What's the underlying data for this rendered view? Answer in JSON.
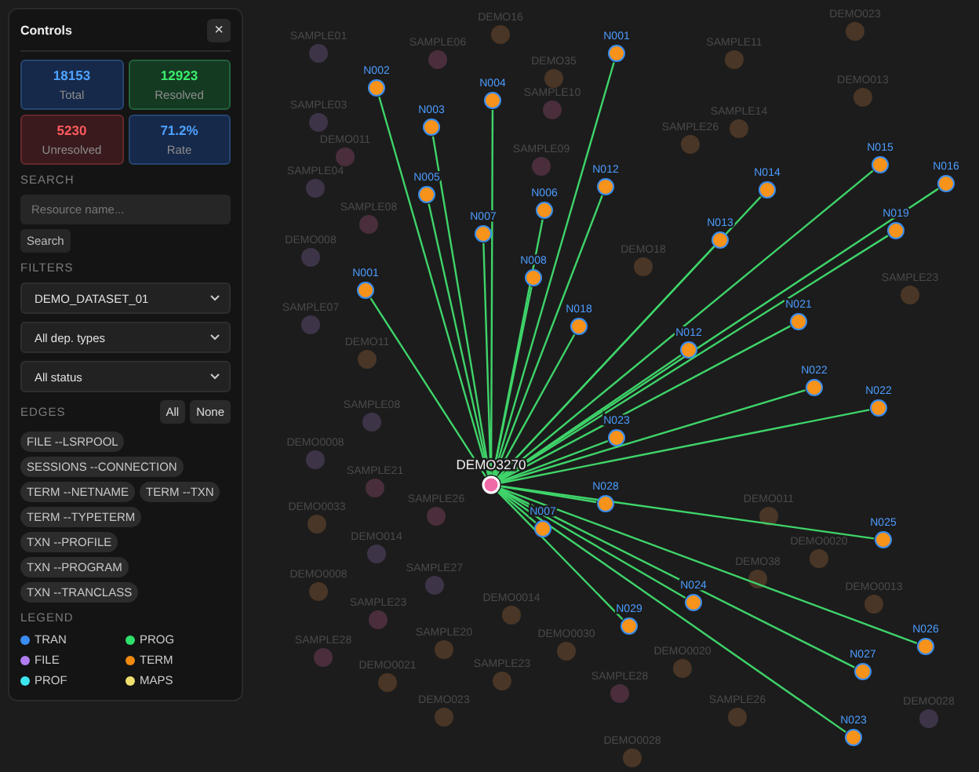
{
  "panel": {
    "title": "Controls",
    "close": "×",
    "stats": [
      {
        "value": "18153",
        "label": "Total",
        "kind": "info"
      },
      {
        "value": "12923",
        "label": "Resolved",
        "kind": "good"
      },
      {
        "value": "5230",
        "label": "Unresolved",
        "kind": "bad"
      },
      {
        "value": "71.2%",
        "label": "Rate",
        "kind": "info"
      }
    ],
    "search": {
      "heading": "SEARCH",
      "placeholder": "Resource name...",
      "button": "Search"
    },
    "filters": {
      "heading": "FILTERS",
      "selects": [
        "DEMO_DATASET_01",
        "All dep. types",
        "All status"
      ]
    },
    "edges": {
      "heading": "EDGES",
      "all": "All",
      "none": "None",
      "chips": [
        "FILE --LSRPOOL",
        "SESSIONS --CONNECTION",
        "TERM --NETNAME",
        "TERM --TXN",
        "TERM --TYPETERM",
        "TXN --PROFILE",
        "TXN --PROGRAM",
        "TXN --TRANCLASS"
      ]
    },
    "legend": {
      "heading": "LEGEND",
      "items": [
        {
          "label": "TRAN",
          "color": "#3b8cf0"
        },
        {
          "label": "PROG",
          "color": "#2ee06a"
        },
        {
          "label": "FILE",
          "color": "#b07cf0"
        },
        {
          "label": "TERM",
          "color": "#f08a10"
        },
        {
          "label": "PROF",
          "color": "#3ce6f0"
        },
        {
          "label": "MAPS",
          "color": "#f0e070"
        }
      ]
    }
  },
  "graph": {
    "center": {
      "label": "DEMO3270",
      "color": "#f06aa8"
    },
    "linked": [
      {
        "label": "N001",
        "color": "#f7931a"
      },
      {
        "label": "N002",
        "color": "#f7931a"
      },
      {
        "label": "N003",
        "color": "#f7931a"
      },
      {
        "label": "N004",
        "color": "#f7931a"
      },
      {
        "label": "N005",
        "color": "#f7931a"
      },
      {
        "label": "N007",
        "color": "#f7931a"
      },
      {
        "label": "N006",
        "color": "#f7931a"
      },
      {
        "label": "N008",
        "color": "#f7931a"
      },
      {
        "label": "N012",
        "color": "#f7931a"
      },
      {
        "label": "N018",
        "color": "#f7931a"
      },
      {
        "label": "N001",
        "color": "#f7931a"
      },
      {
        "label": "N014",
        "color": "#f7931a"
      },
      {
        "label": "N015",
        "color": "#f7931a"
      },
      {
        "label": "N016",
        "color": "#f7931a"
      },
      {
        "label": "N013",
        "color": "#f7931a"
      },
      {
        "label": "N019",
        "color": "#f7931a"
      },
      {
        "label": "N021",
        "color": "#f7931a"
      },
      {
        "label": "N012",
        "color": "#f7931a"
      },
      {
        "label": "N022",
        "color": "#f7931a"
      },
      {
        "label": "N022",
        "color": "#f7931a"
      },
      {
        "label": "N023",
        "color": "#f7931a"
      },
      {
        "label": "N028",
        "color": "#f7931a"
      },
      {
        "label": "N007",
        "color": "#f7931a"
      },
      {
        "label": "N029",
        "color": "#f7931a"
      },
      {
        "label": "N024",
        "color": "#f7931a"
      },
      {
        "label": "N025",
        "color": "#f7931a"
      },
      {
        "label": "N026",
        "color": "#f7931a"
      },
      {
        "label": "N027",
        "color": "#f7931a"
      },
      {
        "label": "N023",
        "color": "#f7931a"
      }
    ],
    "background": [
      {
        "label": "SAMPLE01",
        "color": "#3e3448"
      },
      {
        "label": "SAMPLE06",
        "color": "#4a2e3c"
      },
      {
        "label": "DEMO16",
        "color": "#4a3626"
      },
      {
        "label": "SAMPLE03",
        "color": "#3e3448"
      },
      {
        "label": "DEMO35",
        "color": "#4a3626"
      },
      {
        "label": "DEMO011",
        "color": "#4a2e3c"
      },
      {
        "label": "SAMPLE10",
        "color": "#4a2e3c"
      },
      {
        "label": "SAMPLE09",
        "color": "#4a2e3c"
      },
      {
        "label": "SAMPLE04",
        "color": "#3e3448"
      },
      {
        "label": "DEMO008",
        "color": "#3e3448"
      },
      {
        "label": "SAMPLE08",
        "color": "#4a2e3c"
      },
      {
        "label": "SAMPLE07",
        "color": "#3e3448"
      },
      {
        "label": "DEMO11",
        "color": "#4a3626"
      },
      {
        "label": "DEMO18",
        "color": "#4a3626"
      },
      {
        "label": "SAMPLE11",
        "color": "#4a3626"
      },
      {
        "label": "DEMO023",
        "color": "#4a3626"
      },
      {
        "label": "SAMPLE14",
        "color": "#4a3626"
      },
      {
        "label": "SAMPLE26",
        "color": "#4a3626"
      },
      {
        "label": "DEMO013",
        "color": "#4a3626"
      },
      {
        "label": "SAMPLE23",
        "color": "#4a3626"
      },
      {
        "label": "SAMPLE08",
        "color": "#3e3448"
      },
      {
        "label": "DEMO0008",
        "color": "#3e3448"
      },
      {
        "label": "SAMPLE21",
        "color": "#4a2e3c"
      },
      {
        "label": "DEMO0033",
        "color": "#4a3626"
      },
      {
        "label": "SAMPLE26",
        "color": "#4a2e3c"
      },
      {
        "label": "DEMO014",
        "color": "#3e3448"
      },
      {
        "label": "DEMO0008",
        "color": "#4a3626"
      },
      {
        "label": "SAMPLE27",
        "color": "#3e3448"
      },
      {
        "label": "SAMPLE23",
        "color": "#4a2e3c"
      },
      {
        "label": "DEMO0014",
        "color": "#4a3626"
      },
      {
        "label": "SAMPLE28",
        "color": "#4a2e3c"
      },
      {
        "label": "SAMPLE20",
        "color": "#4a3626"
      },
      {
        "label": "DEMO0021",
        "color": "#4a3626"
      },
      {
        "label": "SAMPLE23",
        "color": "#4a3626"
      },
      {
        "label": "DEMO023",
        "color": "#4a3626"
      },
      {
        "label": "DEMO0030",
        "color": "#4a3626"
      },
      {
        "label": "DEMO011",
        "color": "#4a3626"
      },
      {
        "label": "DEMO0020",
        "color": "#4a3626"
      },
      {
        "label": "DEMO38",
        "color": "#4a3626"
      },
      {
        "label": "DEMO0013",
        "color": "#4a3626"
      },
      {
        "label": "SAMPLE28",
        "color": "#4a2e3c"
      },
      {
        "label": "DEMO0020",
        "color": "#4a3626"
      },
      {
        "label": "SAMPLE26",
        "color": "#4a3626"
      },
      {
        "label": "DEMO028",
        "color": "#3e3448"
      },
      {
        "label": "DEMO0028",
        "color": "#4a3626"
      }
    ]
  }
}
